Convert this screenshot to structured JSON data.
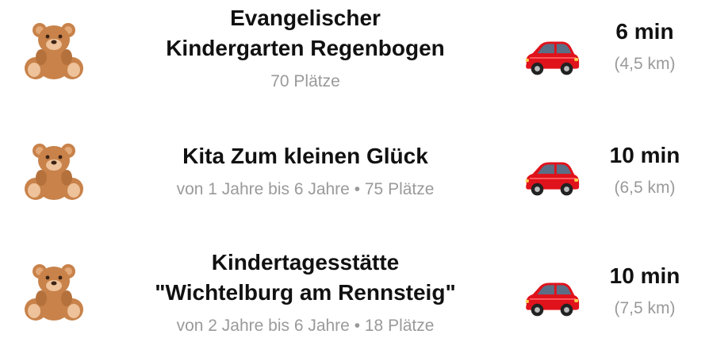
{
  "kindergartens": [
    {
      "name_line1": "Evangelischer",
      "name_line2": "Kindergarten Regenbogen",
      "details": "70 Plätze",
      "drive_time": "6 min",
      "distance": "(4,5 km)",
      "icon": "teddy-bear-icon",
      "transport_icon": "car-icon"
    },
    {
      "name_line1": "Kita Zum kleinen Glück",
      "name_line2": "",
      "details": "von 1 Jahre bis 6 Jahre • 75 Plätze",
      "drive_time": "10 min",
      "distance": "(6,5 km)",
      "icon": "teddy-bear-icon",
      "transport_icon": "car-icon"
    },
    {
      "name_line1": "Kindertagesstätte",
      "name_line2": "\"Wichtelburg am Rennsteig\"",
      "details": "von 2 Jahre bis 6 Jahre • 18 Plätze",
      "drive_time": "10 min",
      "distance": "(7,5 km)",
      "icon": "teddy-bear-icon",
      "transport_icon": "car-icon"
    }
  ],
  "colors": {
    "title": "#111111",
    "secondary": "#9a9a9a",
    "bear_fur": "#c8824a",
    "car_body": "#e0121b"
  }
}
